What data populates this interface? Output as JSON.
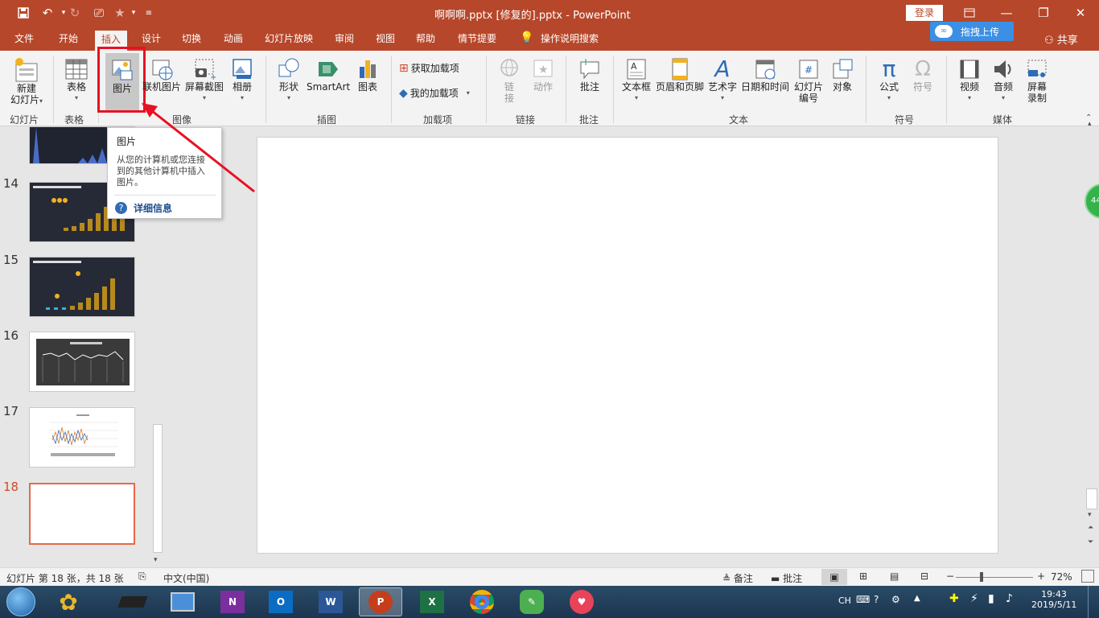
{
  "title": "啊啊啊.pptx [修复的].pptx  -  PowerPoint",
  "login": "登录",
  "upload": "拖拽上传",
  "share": "共享",
  "tabs": [
    "文件",
    "开始",
    "插入",
    "设计",
    "切换",
    "动画",
    "幻灯片放映",
    "审阅",
    "视图",
    "帮助",
    "情节提要"
  ],
  "tell_me": "操作说明搜索",
  "ribbon": {
    "new_slide": [
      "新建",
      "幻灯片"
    ],
    "table": "表格",
    "picture": "图片",
    "online_picture": "联机图片",
    "screenshot": "屏幕截图",
    "album": "相册",
    "shapes": "形状",
    "smartart": "SmartArt",
    "chart": "图表",
    "get_addins": "获取加载项",
    "my_addins": "我的加载项",
    "link": [
      "链",
      "接"
    ],
    "action": "动作",
    "comment": "批注",
    "textbox": "文本框",
    "header_footer": "页眉和页脚",
    "wordart": "艺术字",
    "datetime": "日期和时间",
    "slide_number": [
      "幻灯片",
      "编号"
    ],
    "object": "对象",
    "equation": "公式",
    "symbol": "符号",
    "video": "视频",
    "audio": "音频",
    "screen_record": [
      "屏幕",
      "录制"
    ],
    "groups": {
      "slides": "幻灯片",
      "tables": "表格",
      "images": "图像",
      "illustrations": "插图",
      "addins": "加载项",
      "links": "链接",
      "comments": "批注",
      "text": "文本",
      "symbols": "符号",
      "media": "媒体"
    }
  },
  "tooltip": {
    "title": "图片",
    "body": [
      "从您的计算机或您连接",
      "到的其他计算机中插入",
      "图片。"
    ],
    "more": "详细信息"
  },
  "slides": [
    "14",
    "15",
    "16",
    "17",
    "18"
  ],
  "status": {
    "slide_info": "幻灯片 第 18 张，共 18 张",
    "language": "中文(中国)",
    "notes": "备注",
    "comments": "批注",
    "zoom": "72%"
  },
  "clock": {
    "time": "19:43",
    "date": "2019/5/11"
  },
  "tray_lang": "CH",
  "side_badge": "44",
  "colors": {
    "accent": "#b7472a",
    "highlight": "#e81123"
  }
}
